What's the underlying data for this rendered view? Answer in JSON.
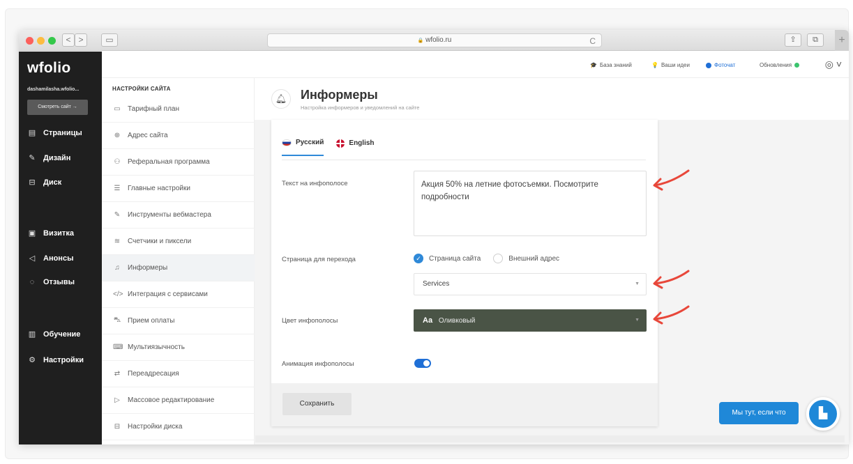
{
  "browser": {
    "url": "wfolio.ru",
    "lock_icon": "🔒",
    "back": "<",
    "forward": ">",
    "reload": "C",
    "new_tab": "+"
  },
  "sidebar": {
    "logo": "wfolio",
    "user": "dashamilasha.wfolio...",
    "view_site": "Смотреть сайт →",
    "items": [
      {
        "label": "Страницы",
        "icon": "page-icon"
      },
      {
        "label": "Дизайн",
        "icon": "brush-icon"
      },
      {
        "label": "Диск",
        "icon": "disk-icon"
      },
      {
        "label": "Визитка",
        "icon": "card-icon"
      },
      {
        "label": "Анонсы",
        "icon": "megaphone-icon"
      },
      {
        "label": "Отзывы",
        "icon": "reviews-icon"
      },
      {
        "label": "Обучение",
        "icon": "book-icon"
      },
      {
        "label": "Настройки",
        "icon": "gear-icon"
      }
    ]
  },
  "topbar": {
    "knowledge_base": "База знаний",
    "your_ideas": "Ваши идеи",
    "photochat": "Фоточат",
    "updates": "Обновления"
  },
  "settings_menu": {
    "heading": "НАСТРОЙКИ САЙТА",
    "items": [
      {
        "label": "Тарифный план"
      },
      {
        "label": "Адрес сайта"
      },
      {
        "label": "Реферальная программа"
      },
      {
        "label": "Главные настройки"
      },
      {
        "label": "Инструменты вебмастера"
      },
      {
        "label": "Счетчики и пиксели"
      },
      {
        "label": "Информеры"
      },
      {
        "label": "Интеграция с сервисами"
      },
      {
        "label": "Прием оплаты"
      },
      {
        "label": "Мультиязычность"
      },
      {
        "label": "Переадресация"
      },
      {
        "label": "Массовое редактирование"
      },
      {
        "label": "Настройки диска"
      }
    ]
  },
  "page": {
    "title": "Информеры",
    "subtitle": "Настройка информеров и уведомлений на сайте",
    "tabs": [
      {
        "label": "Русский"
      },
      {
        "label": "English"
      }
    ],
    "fields": {
      "infobar_text_label": "Текст на инфополосе",
      "infobar_text_value": "Акция 50% на летние фотосъемки. Посмотрите подробности",
      "target_page_label": "Страница для перехода",
      "radio_site_page": "Страница сайта",
      "radio_external": "Внешний адрес",
      "target_page_value": "Services",
      "color_label": "Цвет инфополосы",
      "color_aa": "Aa",
      "color_value": "Оливковый",
      "animation_label": "Анимация инфополосы",
      "animation_on": true
    },
    "save_label": "Сохранить"
  },
  "chat": {
    "pill": "Мы тут, если что"
  },
  "colors": {
    "accent": "#2f89d8",
    "olive": "#4a5446",
    "arrow": "#e8473a",
    "sidebar": "#1f1f1f"
  }
}
